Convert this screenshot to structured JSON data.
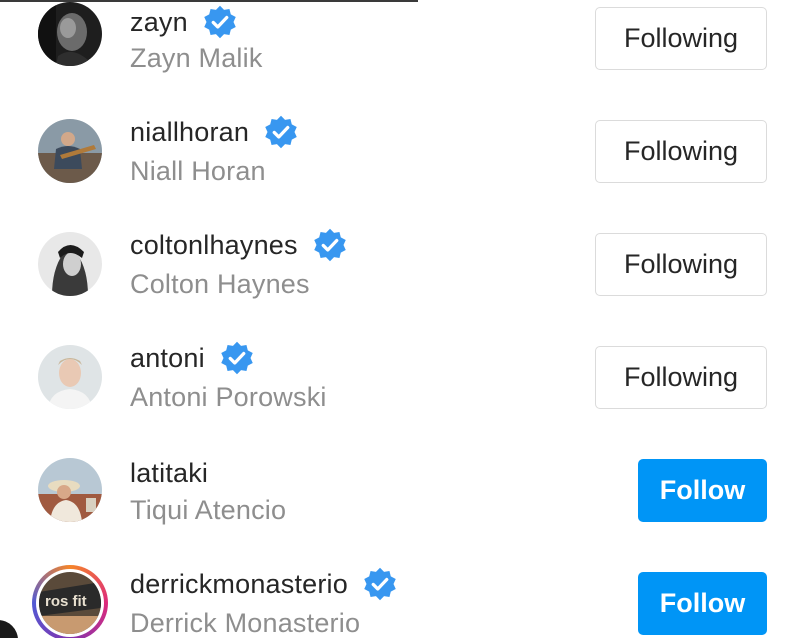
{
  "colors": {
    "verified_badge": "#3897f0",
    "follow_button": "#0095f6",
    "username": "#262626",
    "fullname": "#8e8e8e",
    "following_border": "#dbdbdb"
  },
  "accounts": [
    {
      "username": "zayn",
      "full_name": "Zayn Malik",
      "verified": true,
      "button": "Following"
    },
    {
      "username": "niallhoran",
      "full_name": "Niall Horan",
      "verified": true,
      "button": "Following"
    },
    {
      "username": "coltonlhaynes",
      "full_name": "Colton Haynes",
      "verified": true,
      "button": "Following"
    },
    {
      "username": "antoni",
      "full_name": "Antoni Porowski",
      "verified": true,
      "button": "Following"
    },
    {
      "username": "latitaki",
      "full_name": "Tiqui Atencio",
      "verified": false,
      "button": "Follow"
    },
    {
      "username": "derrickmonasterio",
      "full_name": "Derrick Monasterio",
      "verified": true,
      "button": "Follow",
      "story_ring": true
    }
  ]
}
